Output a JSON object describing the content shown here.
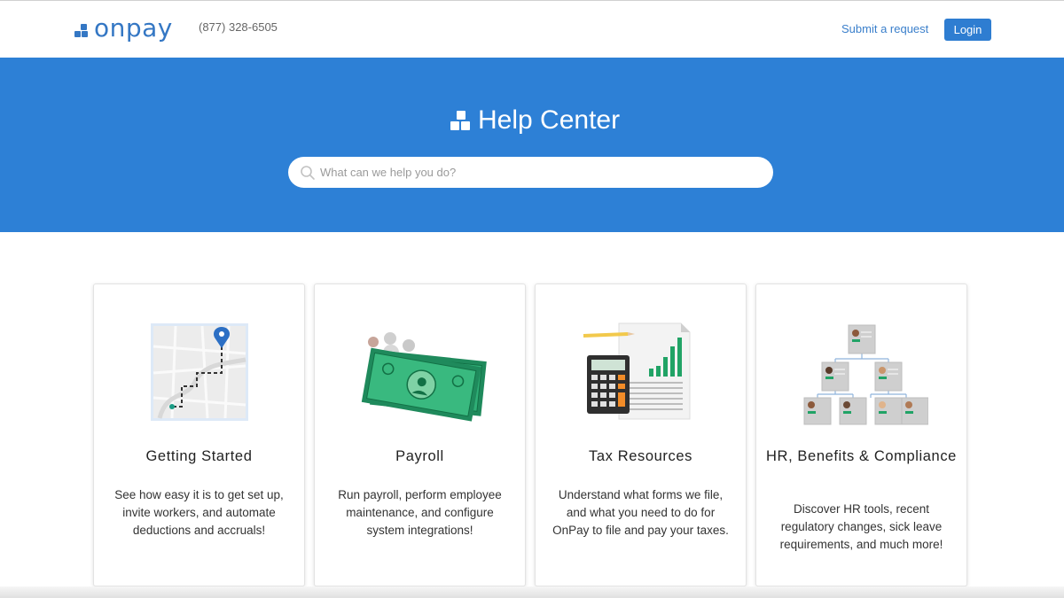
{
  "header": {
    "logo_text": "onpay",
    "phone": "(877) 328-6505",
    "submit_request": "Submit a request",
    "login": "Login"
  },
  "hero": {
    "title": "Help Center",
    "search_placeholder": "What can we help you do?"
  },
  "cards": [
    {
      "title": "Getting Started",
      "description": "See how easy it is to get set up, invite workers, and automate deductions and accruals!",
      "icon": "map-route-icon"
    },
    {
      "title": "Payroll",
      "description": "Run payroll, perform employee maintenance, and configure system integrations!",
      "icon": "money-icon"
    },
    {
      "title": "Tax Resources",
      "description": "Understand what forms we file, and what you need to do for OnPay to file and pay your taxes.",
      "icon": "calculator-document-icon"
    },
    {
      "title": "HR, Benefits & Compliance",
      "description": "Discover HR tools, recent regulatory changes, sick leave requirements, and much more!",
      "icon": "org-chart-icon"
    }
  ],
  "colors": {
    "brand": "#3477c4",
    "hero_background": "#2d80d6",
    "login_button": "#2e7dd1"
  }
}
